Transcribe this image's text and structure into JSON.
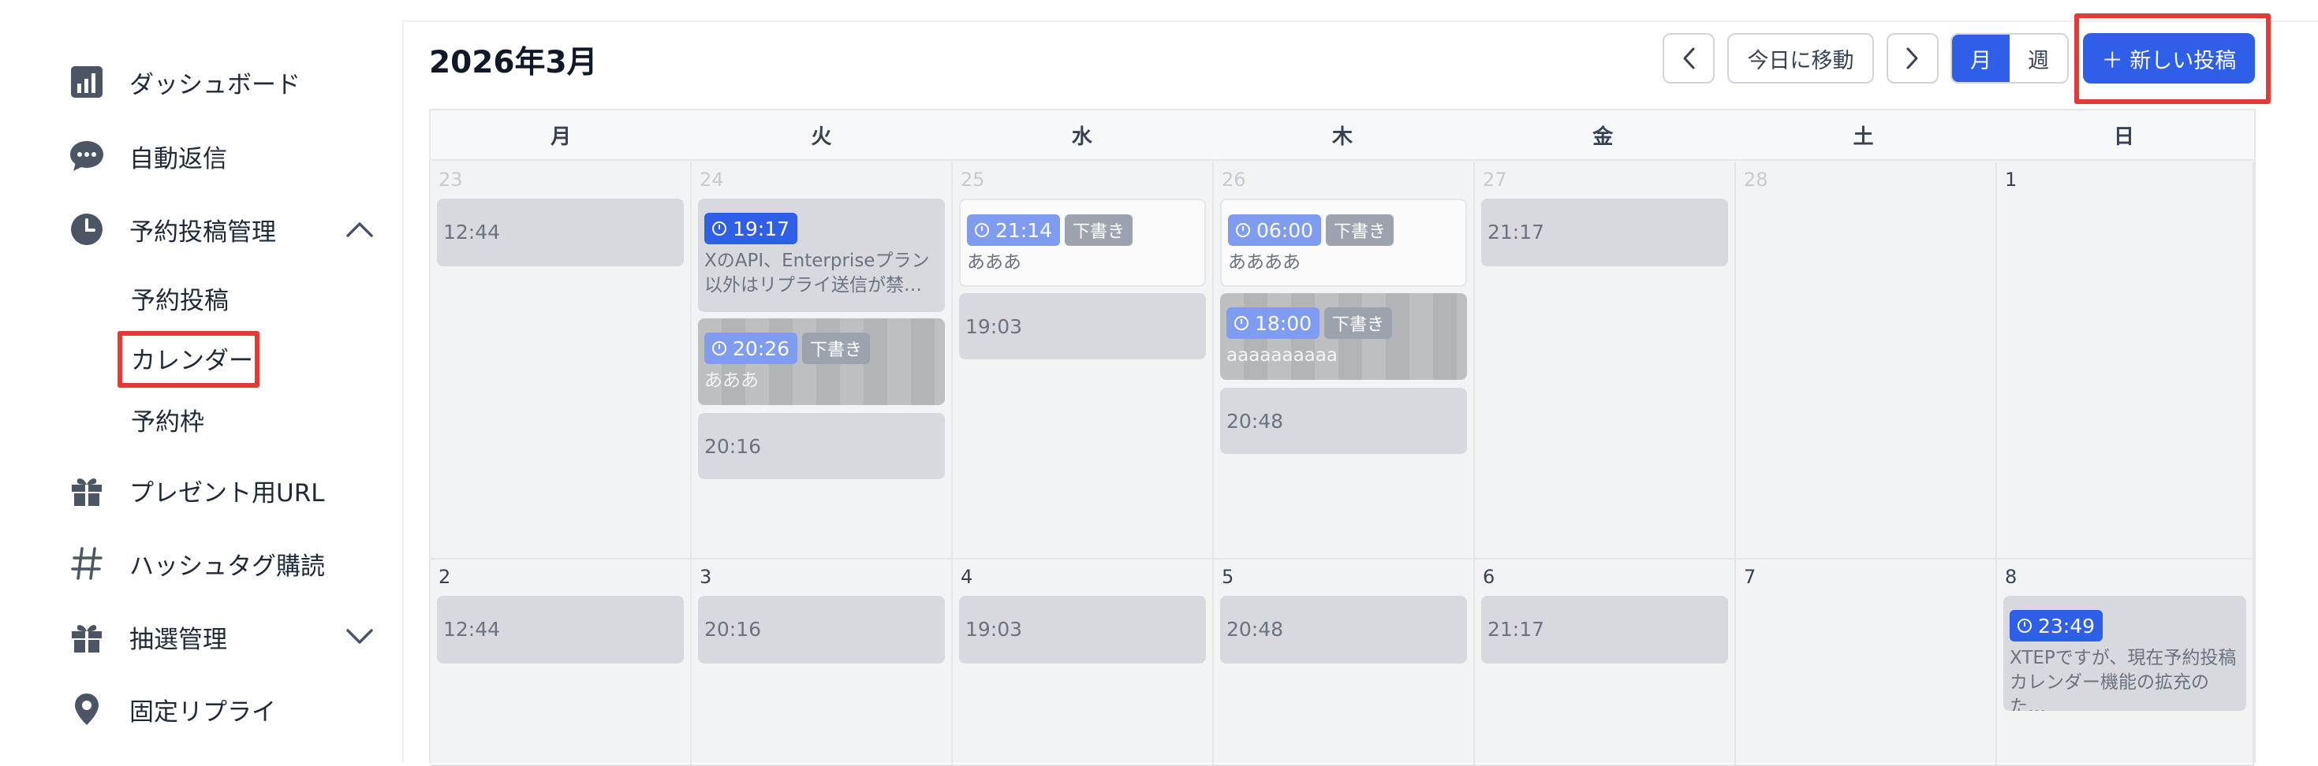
{
  "sidebar": {
    "items": [
      {
        "label": "ダッシュボード",
        "icon": "bar-chart-icon"
      },
      {
        "label": "自動返信",
        "icon": "chat-bubble-icon"
      },
      {
        "label": "予約投稿管理",
        "icon": "clock-icon"
      },
      {
        "label": "プレゼント用URL",
        "icon": "gift-icon"
      },
      {
        "label": "ハッシュタグ購読",
        "icon": "hashtag-icon"
      },
      {
        "label": "抽選管理",
        "icon": "gift-icon"
      },
      {
        "label": "固定リプライ",
        "icon": "location-pin-icon"
      }
    ],
    "subitems": [
      "予約投稿",
      "カレンダー",
      "予約枠"
    ]
  },
  "header": {
    "title": "2026年3月",
    "today_label": "今日に移動",
    "month_label": "月",
    "week_label": "週",
    "new_post_label": "＋ 新しい投稿"
  },
  "calendar": {
    "weekdays": [
      "月",
      "火",
      "水",
      "木",
      "金",
      "土",
      "日"
    ],
    "week1": {
      "days": [
        "23",
        "24",
        "25",
        "26",
        "27",
        "28",
        "1"
      ],
      "mon": {
        "e1": "12:44"
      },
      "tue": {
        "e1_time": "19:17",
        "e1_text": "XのAPI、Enterpriseプラン以外はリプライ送信が禁…",
        "e2_time": "20:26",
        "e2_draft": "下書き",
        "e2_text": "あああ",
        "e3": "20:16"
      },
      "wed": {
        "e1_time": "21:14",
        "e1_draft": "下書き",
        "e1_text": "あああ",
        "e2": "19:03"
      },
      "thu": {
        "e1_time": "06:00",
        "e1_draft": "下書き",
        "e1_text": "ああああ",
        "e2_time": "18:00",
        "e2_draft": "下書き",
        "e2_text": "aaaaaaaaaa",
        "e3": "20:48"
      },
      "fri": {
        "e1": "21:17"
      }
    },
    "week2": {
      "days": [
        "2",
        "3",
        "4",
        "5",
        "6",
        "7",
        "8"
      ],
      "mon": {
        "e1": "12:44"
      },
      "tue": {
        "e1": "20:16"
      },
      "wed": {
        "e1": "19:03"
      },
      "thu": {
        "e1": "20:48"
      },
      "fri": {
        "e1": "21:17"
      },
      "sun": {
        "e1_time": "23:49",
        "e1_text": "XTEPですが、現在予約投稿カレンダー機能の拡充のた…"
      }
    }
  },
  "colors": {
    "accent": "#2f5fe6",
    "highlight": "#e53935"
  }
}
